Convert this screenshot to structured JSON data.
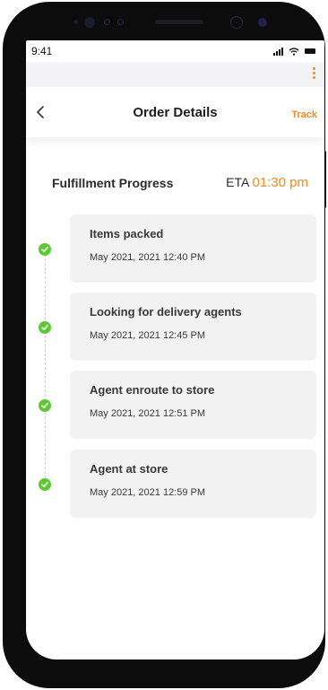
{
  "status_bar": {
    "time": "9:41"
  },
  "header": {
    "title": "Order Details",
    "action_label": "Track"
  },
  "progress": {
    "title": "Fulfillment Progress",
    "eta_label": "ETA",
    "eta_time": "01:30 pm",
    "steps": [
      {
        "label": "Items packed",
        "time": "May 2021, 2021 12:40 PM",
        "completed": true
      },
      {
        "label": "Looking for delivery agents",
        "time": "May 2021, 2021 12:45 PM",
        "completed": true
      },
      {
        "label": "Agent enroute to store",
        "time": "May 2021, 2021 12:51 PM",
        "completed": true
      },
      {
        "label": "Agent at store",
        "time": "May 2021, 2021 12:59 PM",
        "completed": true
      }
    ]
  },
  "colors": {
    "accent": "#f08a24",
    "check": "#5cc935",
    "card": "#f2f2f2"
  },
  "icons": [
    "back-icon",
    "more-icon",
    "signal-icon",
    "wifi-icon",
    "battery-icon",
    "check-icon"
  ]
}
